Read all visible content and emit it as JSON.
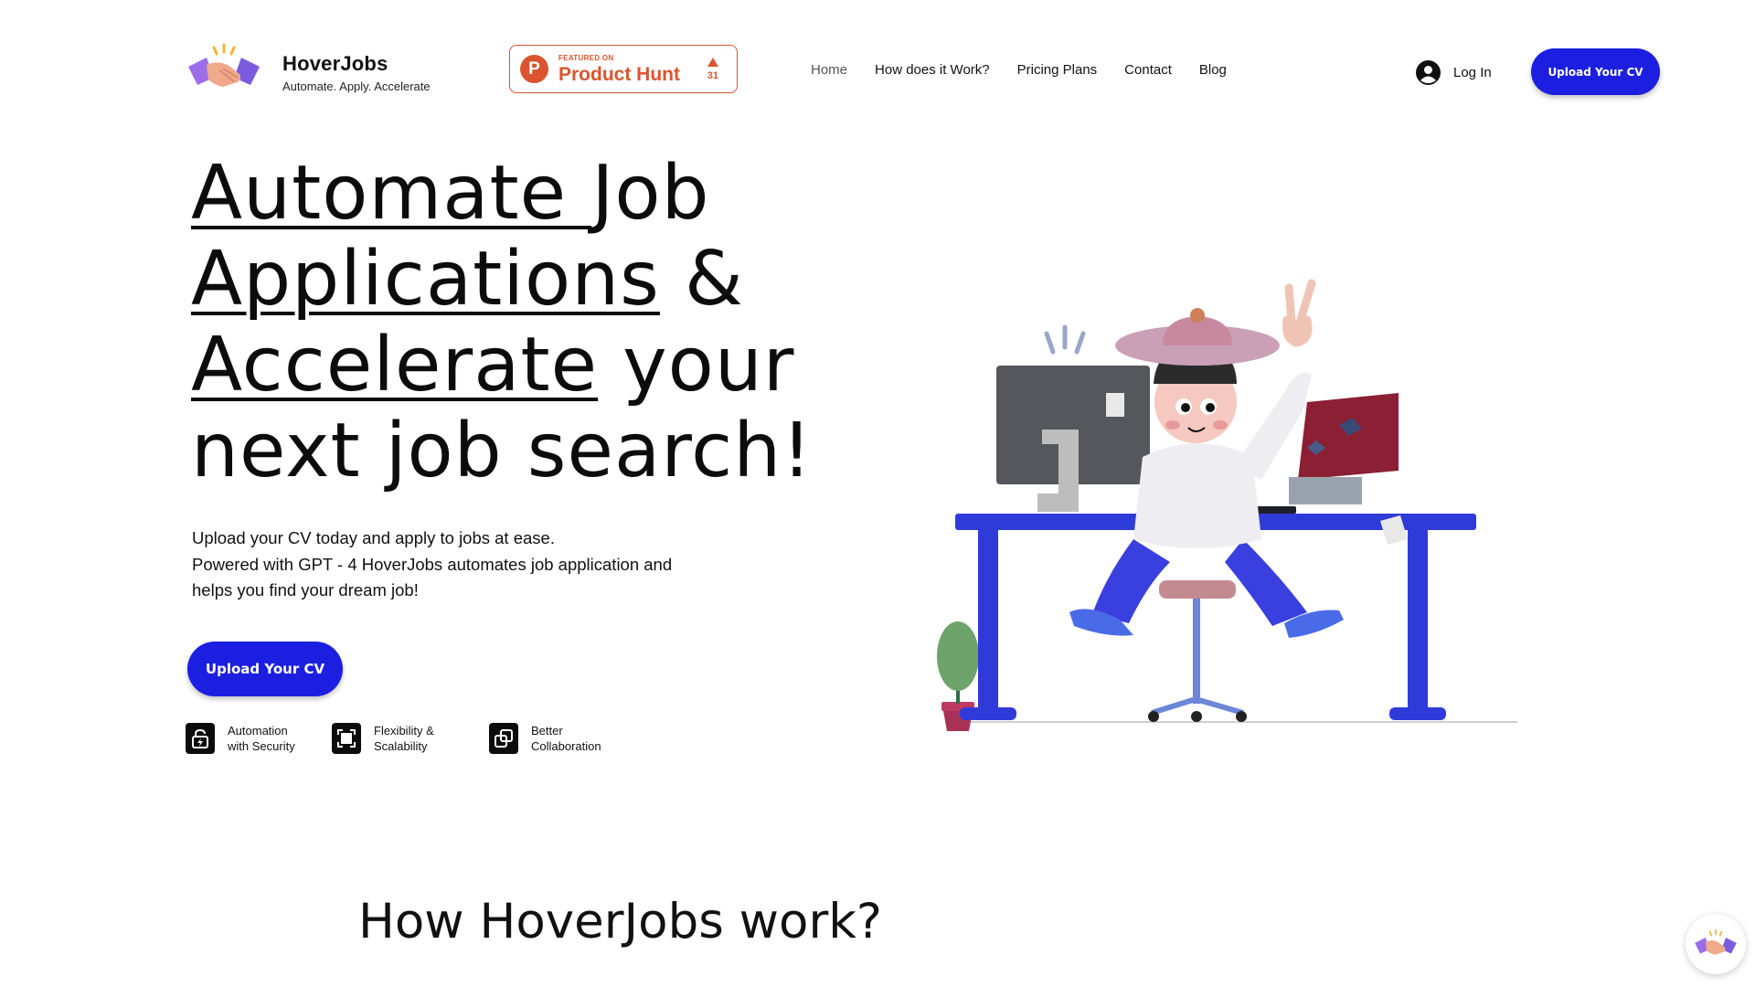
{
  "brand": {
    "name": "HoverJobs",
    "tagline": "Automate. Apply. Accelerate"
  },
  "product_hunt": {
    "featured_label": "FEATURED ON",
    "name": "Product Hunt",
    "logo_letter": "P",
    "votes": "31",
    "color": "#da552f"
  },
  "nav": {
    "items": [
      {
        "label": "Home",
        "active": true
      },
      {
        "label": "How does it Work?"
      },
      {
        "label": "Pricing Plans"
      },
      {
        "label": "Contact"
      },
      {
        "label": "Blog"
      }
    ],
    "login_label": "Log In",
    "cta_label": "Upload Your CV"
  },
  "hero": {
    "title_words": {
      "w1": "Automate ",
      "w2": "Job",
      "w3": "Applications",
      "w4": " &",
      "w5": "Accelerate",
      "w6": " your",
      "w7": "next job search!"
    },
    "description": [
      "Upload your CV today and apply to jobs at ease.",
      "Powered with GPT - 4 HoverJobs automates job application and",
      "helps you find your dream job!"
    ],
    "cta_label": "Upload Your CV",
    "features": [
      {
        "line1": "Automation",
        "line2": "with Security",
        "icon": "lock-icon"
      },
      {
        "line1": "Flexibility &",
        "line2": "Scalability",
        "icon": "expand-icon"
      },
      {
        "line1": "Better",
        "line2": "Collaboration",
        "icon": "collaboration-icon"
      }
    ]
  },
  "section": {
    "how_title": "How HoverJobs work?"
  },
  "colors": {
    "primary": "#1c1fe0",
    "text": "#111111",
    "background": "#ffffff"
  }
}
